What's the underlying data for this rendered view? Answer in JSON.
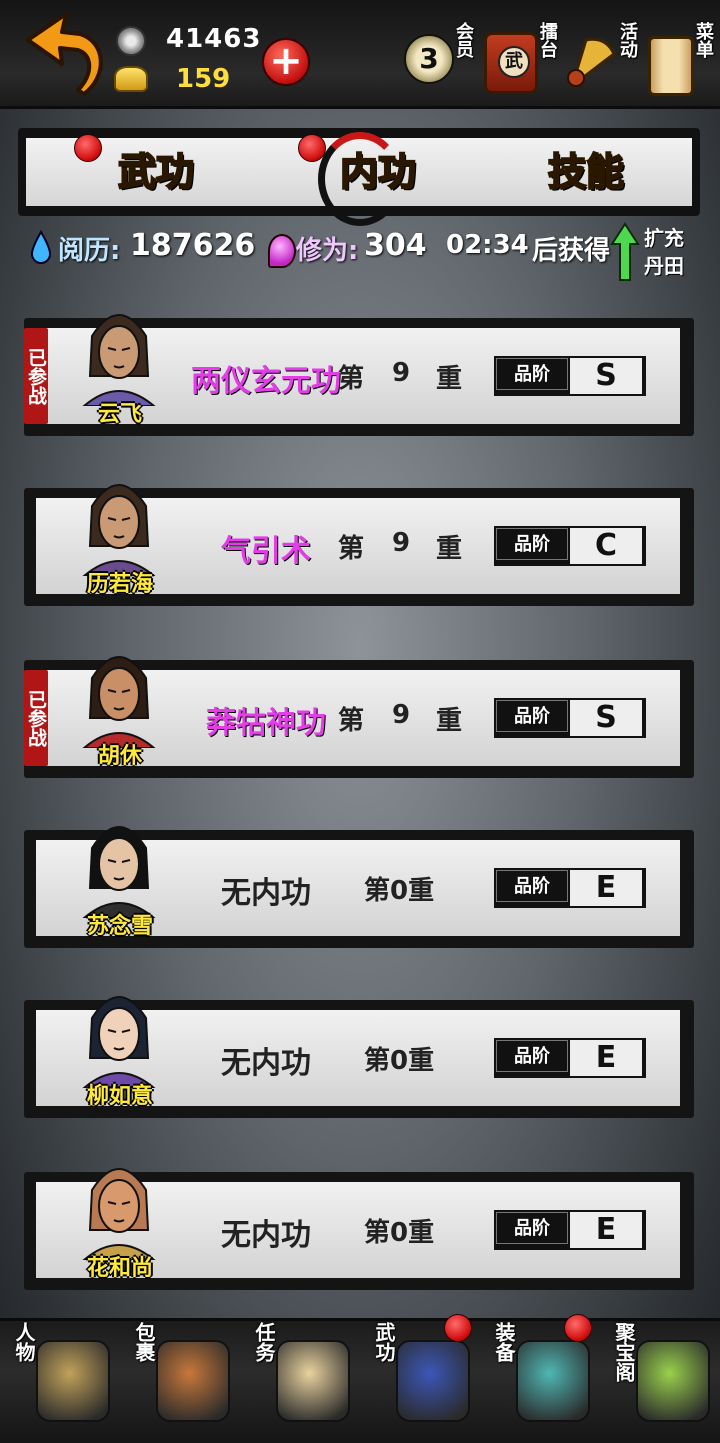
{
  "resources": {
    "coins": "41463",
    "gold": "159"
  },
  "top_menu": {
    "vip_level": "3",
    "vip_label": "会员",
    "arena_badge": "武",
    "arena_label": "擂台",
    "events_label": "活动",
    "menu_label": "菜单"
  },
  "tabs": [
    {
      "label": "武功"
    },
    {
      "label": "内功"
    },
    {
      "label": "技能"
    }
  ],
  "stats": {
    "experience_label": "阅历",
    "experience_value": "187626",
    "cultivation_label": "修为",
    "cultivation_value": "304",
    "timer": "02:34",
    "timer_suffix": "后获得",
    "expand_label_1": "扩充",
    "expand_label_2": "丹田"
  },
  "heroes": [
    {
      "name": "云飞",
      "skill": "两仪玄元功",
      "level_prefix": "第",
      "level": "9",
      "level_suffix": "重",
      "grade_label": "品阶",
      "grade": "S",
      "deployed": "已参战"
    },
    {
      "name": "历若海",
      "skill": "气引术",
      "level_prefix": "第",
      "level": "9",
      "level_suffix": "重",
      "grade_label": "品阶",
      "grade": "C"
    },
    {
      "name": "胡休",
      "skill": "莽牯神功",
      "level_prefix": "第",
      "level": "9",
      "level_suffix": "重",
      "grade_label": "品阶",
      "grade": "S",
      "deployed": "已参战"
    },
    {
      "name": "苏念雪",
      "skill": "无内功",
      "level_text": "第0重",
      "grade_label": "品阶",
      "grade": "E"
    },
    {
      "name": "柳如意",
      "skill": "无内功",
      "level_text": "第0重",
      "grade_label": "品阶",
      "grade": "E"
    },
    {
      "name": "花和尚",
      "skill": "无内功",
      "level_text": "第0重",
      "grade_label": "品阶",
      "grade": "E"
    }
  ],
  "bottom_nav": [
    {
      "label": "人物",
      "icon": "straw-hat-icon"
    },
    {
      "label": "包裹",
      "icon": "bag-icon"
    },
    {
      "label": "任务",
      "icon": "scroll-icon"
    },
    {
      "label": "武功",
      "icon": "book-icon"
    },
    {
      "label": "装备",
      "icon": "sword-icon"
    },
    {
      "label": "聚宝阁",
      "icon": "treasure-icon"
    }
  ],
  "colors": {
    "skill_purple": "#e23de6",
    "name_yellow": "#ffe93a",
    "tab_gold": "#f1b21e",
    "badge_red": "#d10f0f"
  }
}
